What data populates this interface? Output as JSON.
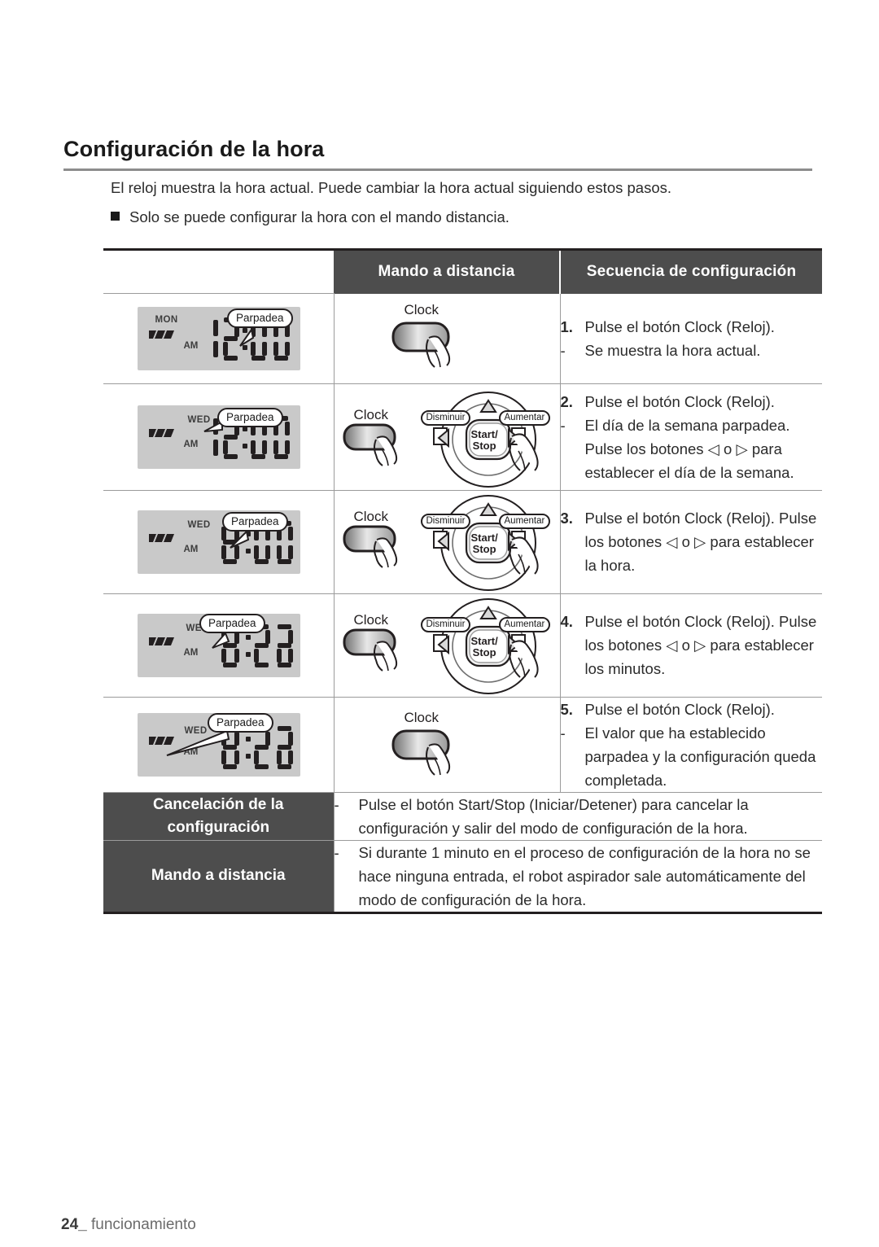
{
  "heading": "Configuración de la hora",
  "intro": {
    "paragraph": "El reloj muestra la hora actual. Puede cambiar la hora actual siguiendo estos pasos.",
    "bullet": "Solo se puede configurar la hora con el mando distancia."
  },
  "table": {
    "headers": {
      "blank": "",
      "remote": "Mando a distancia",
      "sequence": "Secuencia de configuración"
    },
    "rows": [
      {
        "lcd": {
          "day": "MON",
          "am": "AM",
          "hour": "12",
          "minute": "00",
          "bubble": "Parpadea",
          "signal_icon": "signal-bars-icon"
        },
        "remote": {
          "clock_label": "Clock",
          "has_dpad": false
        },
        "steps": [
          {
            "marker": "1.",
            "text": "Pulse el botón Clock (Reloj)."
          },
          {
            "marker": "-",
            "text": "Se muestra la hora actual."
          }
        ]
      },
      {
        "lcd": {
          "day": "WED",
          "am": "AM",
          "hour": "12",
          "minute": "00",
          "bubble": "Parpadea",
          "signal_icon": "signal-bars-icon"
        },
        "remote": {
          "clock_label": "Clock",
          "has_dpad": true,
          "left_label": "Disminuir",
          "right_label": "Aumentar",
          "center_label_1": "Start/",
          "center_label_2": "Stop"
        },
        "steps": [
          {
            "marker": "2.",
            "text": "Pulse el botón Clock (Reloj)."
          },
          {
            "marker": "-",
            "text": "El día de la semana parpadea. Pulse los botones ◁ o ▷ para establecer el día de la semana."
          }
        ]
      },
      {
        "lcd": {
          "day": "WED",
          "am": "AM",
          "hour": "8",
          "minute": "00",
          "bubble": "Parpadea",
          "signal_icon": "signal-bars-icon"
        },
        "remote": {
          "clock_label": "Clock",
          "has_dpad": true,
          "left_label": "Disminuir",
          "right_label": "Aumentar",
          "center_label_1": "Start/",
          "center_label_2": "Stop"
        },
        "steps": [
          {
            "marker": "3.",
            "text": "Pulse el botón Clock (Reloj). Pulse los botones ◁ o ▷ para establecer la hora."
          }
        ]
      },
      {
        "lcd": {
          "day": "WED",
          "am": "AM",
          "hour": "8",
          "minute": "30",
          "bubble": "Parpadea",
          "signal_icon": "signal-bars-icon"
        },
        "remote": {
          "clock_label": "Clock",
          "has_dpad": true,
          "left_label": "Disminuir",
          "right_label": "Aumentar",
          "center_label_1": "Start/",
          "center_label_2": "Stop"
        },
        "steps": [
          {
            "marker": "4.",
            "text": "Pulse el botón Clock (Reloj). Pulse los botones ◁ o ▷ para establecer los minutos."
          }
        ]
      },
      {
        "lcd": {
          "day": "WED",
          "am": "AM",
          "hour": "8",
          "minute": "30",
          "bubble": "Parpadea",
          "signal_icon": "signal-bars-icon"
        },
        "remote": {
          "clock_label": "Clock",
          "has_dpad": false
        },
        "steps": [
          {
            "marker": "5.",
            "text": "Pulse el botón Clock (Reloj)."
          },
          {
            "marker": "-",
            "text": "El valor que ha establecido parpadea y la configuración queda completada."
          }
        ]
      }
    ],
    "notes": [
      {
        "label_line_1": "Cancelación de la",
        "label_line_2": "configuración",
        "dash": "-",
        "text": "Pulse el botón Start/Stop (Iniciar/Detener) para cancelar la configuración y salir del modo de configuración de la hora."
      },
      {
        "label_line_1": "Mando a distancia",
        "label_line_2": "",
        "dash": "-",
        "text": "Si durante 1 minuto en el proceso de configuración de la hora no se hace ninguna entrada, el robot aspirador sale automáticamente del modo de configuración de la hora."
      }
    ]
  },
  "footer": {
    "page_number": "24_",
    "section": "funcionamiento"
  },
  "colors": {
    "dark_header": "#4d4d4d",
    "rule": "#8d8d8d",
    "lcd_bg": "#c9c9c9",
    "ink": "#231f20"
  }
}
